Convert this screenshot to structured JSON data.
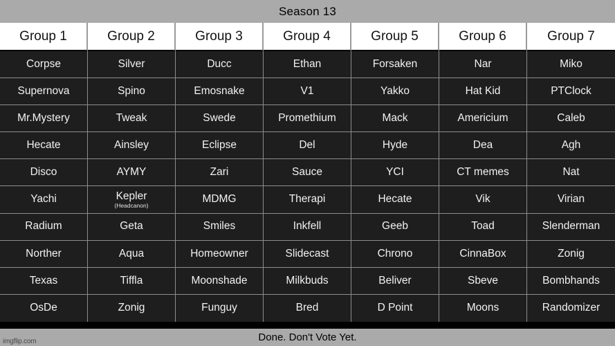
{
  "banner": {
    "title": "Season 13"
  },
  "footer": {
    "text": "Done. Don't Vote Yet.",
    "watermark": "imgflip.com"
  },
  "table": {
    "headers": [
      "Group 1",
      "Group 2",
      "Group 3",
      "Group 4",
      "Group 5",
      "Group 6",
      "Group 7"
    ],
    "rows": [
      [
        {
          "name": "Corpse"
        },
        {
          "name": "Silver"
        },
        {
          "name": "Ducc"
        },
        {
          "name": "Ethan"
        },
        {
          "name": "Forsaken"
        },
        {
          "name": "Nar"
        },
        {
          "name": "Miko"
        }
      ],
      [
        {
          "name": "Supernova"
        },
        {
          "name": "Spino"
        },
        {
          "name": "Emosnake"
        },
        {
          "name": "V1"
        },
        {
          "name": "Yakko"
        },
        {
          "name": "Hat Kid"
        },
        {
          "name": "PTClock"
        }
      ],
      [
        {
          "name": "Mr.Mystery"
        },
        {
          "name": "Tweak"
        },
        {
          "name": "Swede"
        },
        {
          "name": "Promethium"
        },
        {
          "name": "Mack"
        },
        {
          "name": "Americium"
        },
        {
          "name": "Caleb"
        }
      ],
      [
        {
          "name": "Hecate"
        },
        {
          "name": "Ainsley"
        },
        {
          "name": "Eclipse"
        },
        {
          "name": "Del"
        },
        {
          "name": "Hyde"
        },
        {
          "name": "Dea"
        },
        {
          "name": "Agh"
        }
      ],
      [
        {
          "name": "Disco"
        },
        {
          "name": "AYMY"
        },
        {
          "name": "Zari"
        },
        {
          "name": "Sauce"
        },
        {
          "name": "YCI"
        },
        {
          "name": "CT memes"
        },
        {
          "name": "Nat"
        }
      ],
      [
        {
          "name": "Yachi"
        },
        {
          "name": "Kepler",
          "sub": "(Headcanon)"
        },
        {
          "name": "MDMG"
        },
        {
          "name": "Therapi"
        },
        {
          "name": "Hecate"
        },
        {
          "name": "Vik"
        },
        {
          "name": "Virian"
        }
      ],
      [
        {
          "name": "Radium"
        },
        {
          "name": "Geta"
        },
        {
          "name": "Smiles"
        },
        {
          "name": "Inkfell"
        },
        {
          "name": "Geeb"
        },
        {
          "name": "Toad"
        },
        {
          "name": "Slenderman"
        }
      ],
      [
        {
          "name": "Norther"
        },
        {
          "name": "Aqua"
        },
        {
          "name": "Homeowner"
        },
        {
          "name": "Slidecast"
        },
        {
          "name": "Chrono"
        },
        {
          "name": "CinnaBox"
        },
        {
          "name": "Zonig"
        }
      ],
      [
        {
          "name": "Texas"
        },
        {
          "name": "Tiffla"
        },
        {
          "name": "Moonshade"
        },
        {
          "name": "Milkbuds"
        },
        {
          "name": "Beliver"
        },
        {
          "name": "Sbeve"
        },
        {
          "name": "Bombhands"
        }
      ],
      [
        {
          "name": "OsDe"
        },
        {
          "name": "Zonig"
        },
        {
          "name": "Funguy"
        },
        {
          "name": "Bred"
        },
        {
          "name": "D Point"
        },
        {
          "name": "Moons"
        },
        {
          "name": "Randomizer"
        }
      ]
    ]
  },
  "colors": {
    "banner_bg": "#aaaaaa",
    "cell_bg": "#1e1e1e",
    "cell_text": "#f2f2f2",
    "header_bg": "#ffffff",
    "grid_line": "#8d8d8d",
    "page_bg": "#000000"
  }
}
